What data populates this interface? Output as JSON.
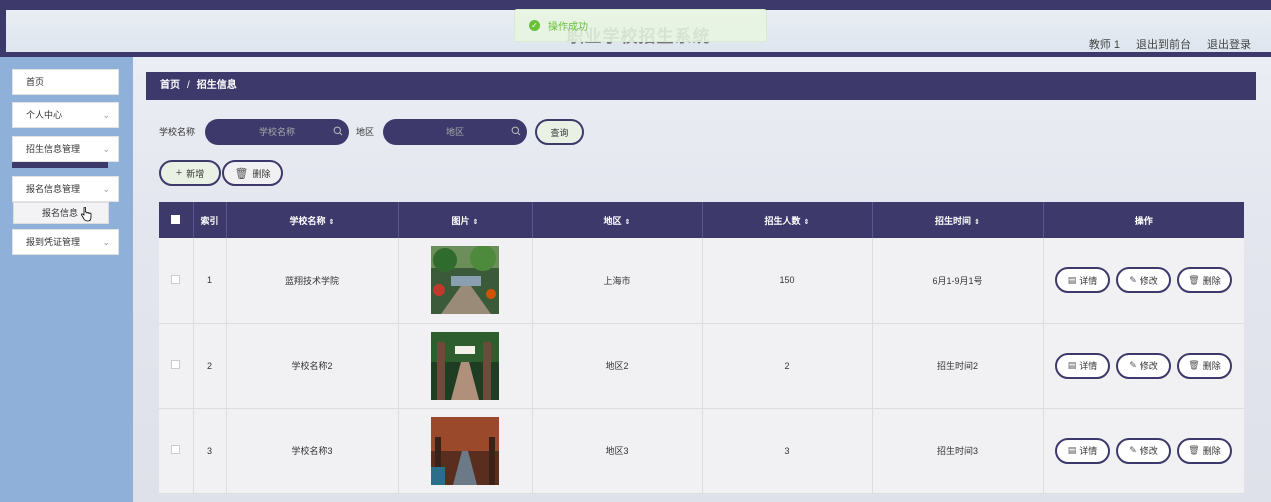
{
  "header": {
    "title": "职业学校招生系统",
    "toast": "操作成功",
    "links": [
      "教师 1",
      "退出到前台",
      "退出登录"
    ]
  },
  "sidebar": {
    "items": [
      {
        "label": "首页",
        "has_chevron": false
      },
      {
        "label": "个人中心",
        "has_chevron": true
      },
      {
        "label": "招生信息管理",
        "has_chevron": true
      },
      {
        "label": "报名信息管理",
        "has_chevron": true
      },
      {
        "label": "报到凭证管理",
        "has_chevron": true
      }
    ],
    "submenu": {
      "label": "报名信息"
    }
  },
  "breadcrumb": {
    "home": "首页",
    "separator": "/",
    "current": "招生信息"
  },
  "search": {
    "school_label": "学校名称",
    "school_placeholder": "学校名称",
    "region_label": "地区",
    "region_placeholder": "地区",
    "query_button": "查询"
  },
  "toolbar": {
    "add_button": "新增",
    "delete_button": "删除"
  },
  "table": {
    "headers": [
      "索引",
      "学校名称",
      "图片",
      "地区",
      "招生人数",
      "招生时间",
      "操作"
    ],
    "rows": [
      {
        "index": "1",
        "school": "蓝翔技术学院",
        "region": "上海市",
        "count": "150",
        "time": "6月1-9月1号"
      },
      {
        "index": "2",
        "school": "学校名称2",
        "region": "地区2",
        "count": "2",
        "time": "招生时间2"
      },
      {
        "index": "3",
        "school": "学校名称3",
        "region": "地区3",
        "count": "3",
        "time": "招生时间3"
      }
    ],
    "actions": {
      "detail": "详情",
      "edit": "修改",
      "delete": "删除"
    }
  },
  "colors": {
    "primary": "#3d3a6b",
    "sidebar_bg": "#8fb0d8",
    "success": "#67c23a"
  }
}
